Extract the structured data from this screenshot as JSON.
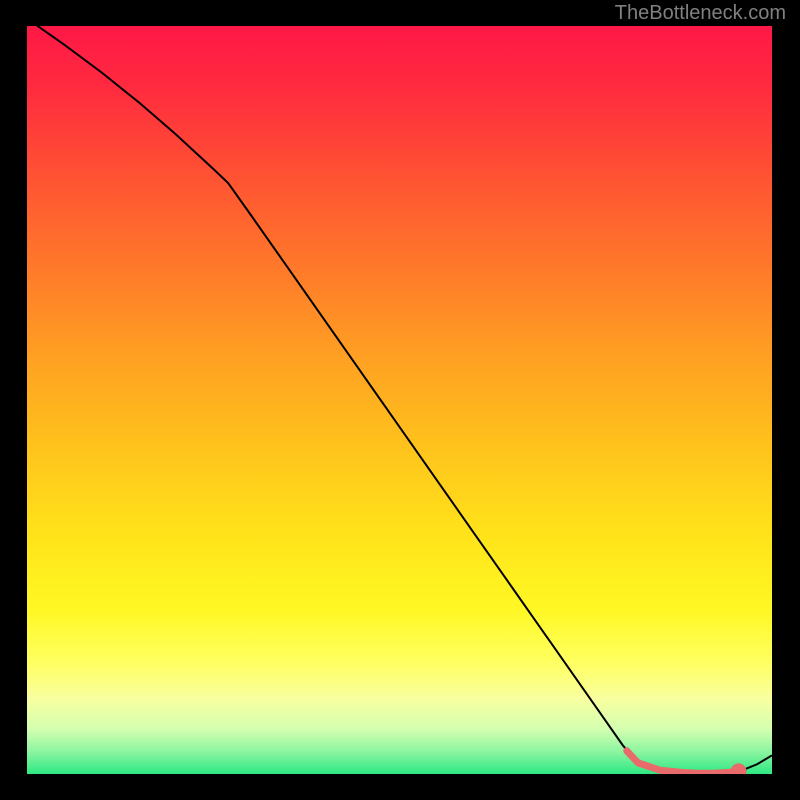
{
  "watermark": "TheBottleneck.com",
  "chart_data": {
    "type": "line",
    "title": "",
    "xlabel": "",
    "ylabel": "",
    "xlim": [
      0,
      100
    ],
    "ylim": [
      0,
      100
    ],
    "series": [
      {
        "name": "curve",
        "color": "#000000",
        "stroke_width": 2,
        "x": [
          0,
          5,
          10,
          15,
          20,
          25,
          27,
          30,
          35,
          40,
          45,
          50,
          55,
          60,
          65,
          70,
          75,
          80,
          82,
          85,
          88,
          90,
          92,
          94,
          96,
          98,
          100
        ],
        "y": [
          101,
          97.5,
          93.8,
          89.8,
          85.5,
          80.9,
          79,
          74.8,
          67.7,
          60.6,
          53.5,
          46.4,
          39.3,
          32.2,
          25.1,
          18.0,
          10.9,
          3.8,
          1.5,
          0.5,
          0.2,
          0.1,
          0.1,
          0.2,
          0.5,
          1.3,
          2.5
        ]
      },
      {
        "name": "highlight",
        "color": "#e96a6a",
        "stroke_width": 7,
        "linecap": "round",
        "x": [
          80.5,
          82,
          85,
          88,
          90,
          92,
          94,
          95.5
        ],
        "y": [
          3.1,
          1.5,
          0.5,
          0.2,
          0.1,
          0.1,
          0.2,
          0.35
        ]
      }
    ],
    "marker": {
      "x": 95.5,
      "y": 0.35,
      "color": "#e96a6a",
      "radius": 8
    },
    "gradient_stops": [
      {
        "offset": 0.0,
        "color": "#ff1846"
      },
      {
        "offset": 0.08,
        "color": "#ff2a3f"
      },
      {
        "offset": 0.2,
        "color": "#ff5233"
      },
      {
        "offset": 0.32,
        "color": "#ff782a"
      },
      {
        "offset": 0.44,
        "color": "#ff9f22"
      },
      {
        "offset": 0.56,
        "color": "#ffc21c"
      },
      {
        "offset": 0.68,
        "color": "#ffe31a"
      },
      {
        "offset": 0.78,
        "color": "#fff824"
      },
      {
        "offset": 0.85,
        "color": "#ffff60"
      },
      {
        "offset": 0.9,
        "color": "#f8ffa0"
      },
      {
        "offset": 0.94,
        "color": "#d4ffb0"
      },
      {
        "offset": 0.97,
        "color": "#8cf5a0"
      },
      {
        "offset": 1.0,
        "color": "#2de884"
      }
    ]
  }
}
